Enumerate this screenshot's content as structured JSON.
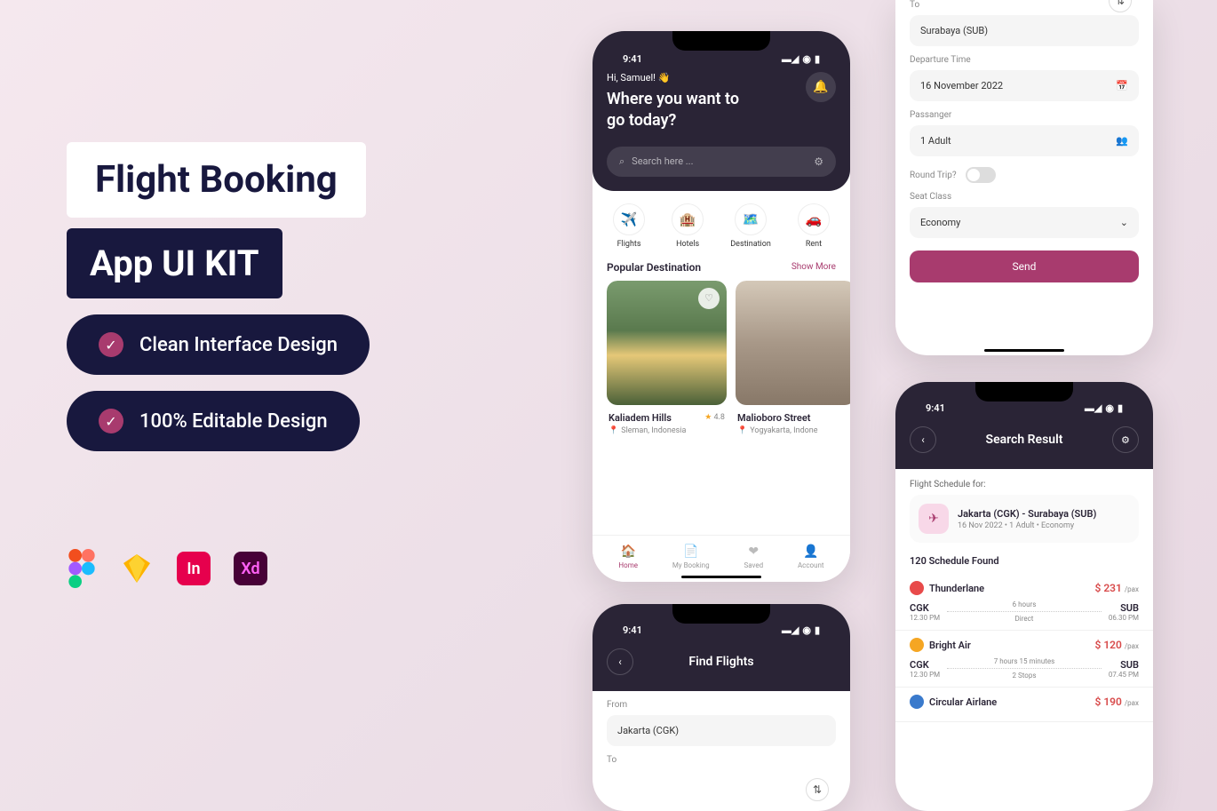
{
  "marketing": {
    "title1": "Flight Booking",
    "title2": "App UI KIT",
    "features": [
      "Clean Interface Design",
      "100% Editable Design"
    ],
    "apps": [
      "Fg",
      "Sk",
      "In",
      "Xd"
    ]
  },
  "status_time": "9:41",
  "home": {
    "greeting": "Hi, Samuel! 👋",
    "headline1": "Where you want to",
    "headline2": "go today?",
    "search_placeholder": "Search here ...",
    "categories": [
      {
        "icon": "✈️",
        "label": "Flights"
      },
      {
        "icon": "🏨",
        "label": "Hotels"
      },
      {
        "icon": "🗺️",
        "label": "Destination"
      },
      {
        "icon": "🚗",
        "label": "Rent"
      }
    ],
    "popular_title": "Popular Destination",
    "show_more": "Show More",
    "destinations": [
      {
        "name": "Kaliadem Hills",
        "rating": "4.8",
        "location": "Sleman, Indonesia"
      },
      {
        "name": "Malioboro Street",
        "location": "Yogyakarta, Indone"
      }
    ],
    "nav": [
      {
        "label": "Home",
        "active": true
      },
      {
        "label": "My Booking",
        "active": false
      },
      {
        "label": "Saved",
        "active": false
      },
      {
        "label": "Account",
        "active": false
      }
    ]
  },
  "find": {
    "title": "Find Flights",
    "from_label": "From",
    "from_value": "Jakarta (CGK)",
    "to_label": "To",
    "to_value": "Surabaya (SUB)",
    "departure_label": "Departure Time",
    "departure_value": "16 November 2022",
    "passenger_label": "Passanger",
    "passenger_value": "1 Adult",
    "roundtrip_label": "Round Trip?",
    "seat_label": "Seat Class",
    "seat_value": "Economy",
    "send_button": "Send"
  },
  "results": {
    "title": "Search Result",
    "schedule_for": "Flight Schedule for:",
    "route": "Jakarta (CGK) - Surabaya (SUB)",
    "meta": "16 Nov 2022  •  1 Adult   •   Economy",
    "found": "120 Schedule Found",
    "flights": [
      {
        "airline": "Thunderlane",
        "price": "$ 231",
        "pax": "/pax",
        "from_code": "CGK",
        "from_time": "12.30 PM",
        "to_code": "SUB",
        "to_time": "06.30 PM",
        "duration": "6 hours",
        "stops": "Direct",
        "logoColor": "#e84a4a"
      },
      {
        "airline": "Bright Air",
        "price": "$ 120",
        "pax": "/pax",
        "from_code": "CGK",
        "from_time": "12.30 PM",
        "to_code": "SUB",
        "to_time": "07.45 PM",
        "duration": "7 hours  15 minutes",
        "stops": "2 Stops",
        "logoColor": "#f5a623"
      },
      {
        "airline": "Circular Airlane",
        "price": "$ 190",
        "pax": "/pax",
        "logoColor": "#3a7acc"
      }
    ]
  }
}
